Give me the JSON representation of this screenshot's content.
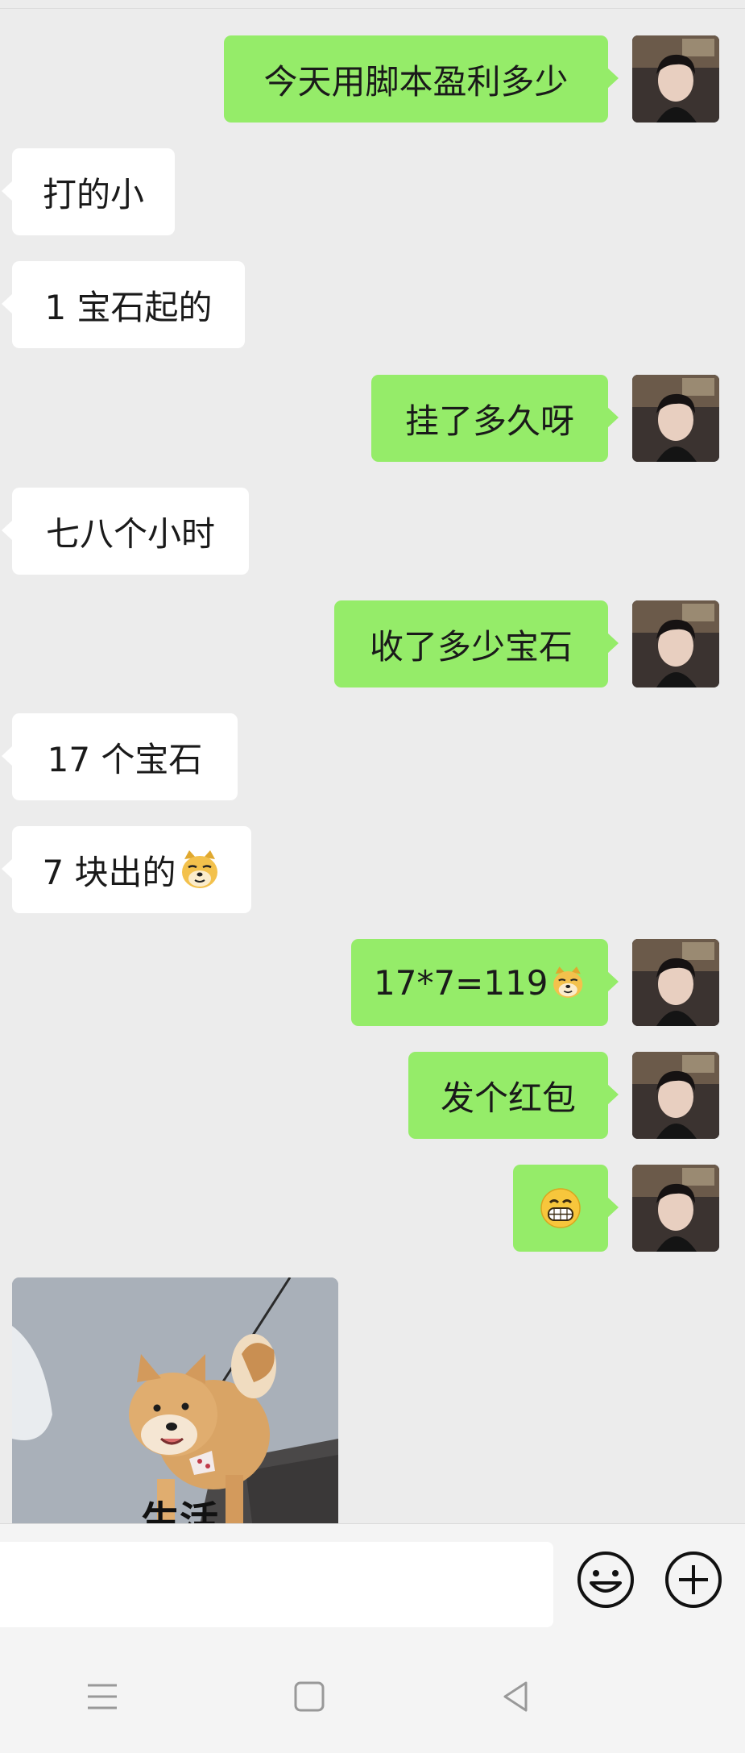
{
  "messages": [
    {
      "side": "mine",
      "text": "今天用脚本盈利多少"
    },
    {
      "side": "theirs",
      "text": "打的小"
    },
    {
      "side": "theirs",
      "text": "1 宝石起的"
    },
    {
      "side": "mine",
      "text": "挂了多久呀"
    },
    {
      "side": "theirs",
      "text": "七八个小时"
    },
    {
      "side": "mine",
      "text": "收了多少宝石"
    },
    {
      "side": "theirs",
      "text": "17 个宝石"
    },
    {
      "side": "theirs",
      "text": "7 块出的",
      "emoji": "doge-emoji"
    },
    {
      "side": "mine",
      "text": "17*7=119",
      "emoji": "doge-emoji"
    },
    {
      "side": "mine",
      "text": "发个红包"
    },
    {
      "side": "mine",
      "text": "",
      "emoji": "grin-emoji"
    },
    {
      "side": "theirs",
      "type": "image",
      "image": "shiba-inu-dog-photo"
    }
  ],
  "composer": {
    "input_value": "",
    "emoji_icon": "smiley-face-icon",
    "more_icon": "plus-circle-icon"
  },
  "navigation": {
    "menu_icon": "menu-lines-icon",
    "home_icon": "square-home-icon",
    "back_icon": "triangle-back-icon"
  },
  "colors": {
    "background": "#ececec",
    "outgoing_bubble": "#95ec69",
    "incoming_bubble": "#ffffff",
    "bar_background": "#f4f4f4"
  }
}
